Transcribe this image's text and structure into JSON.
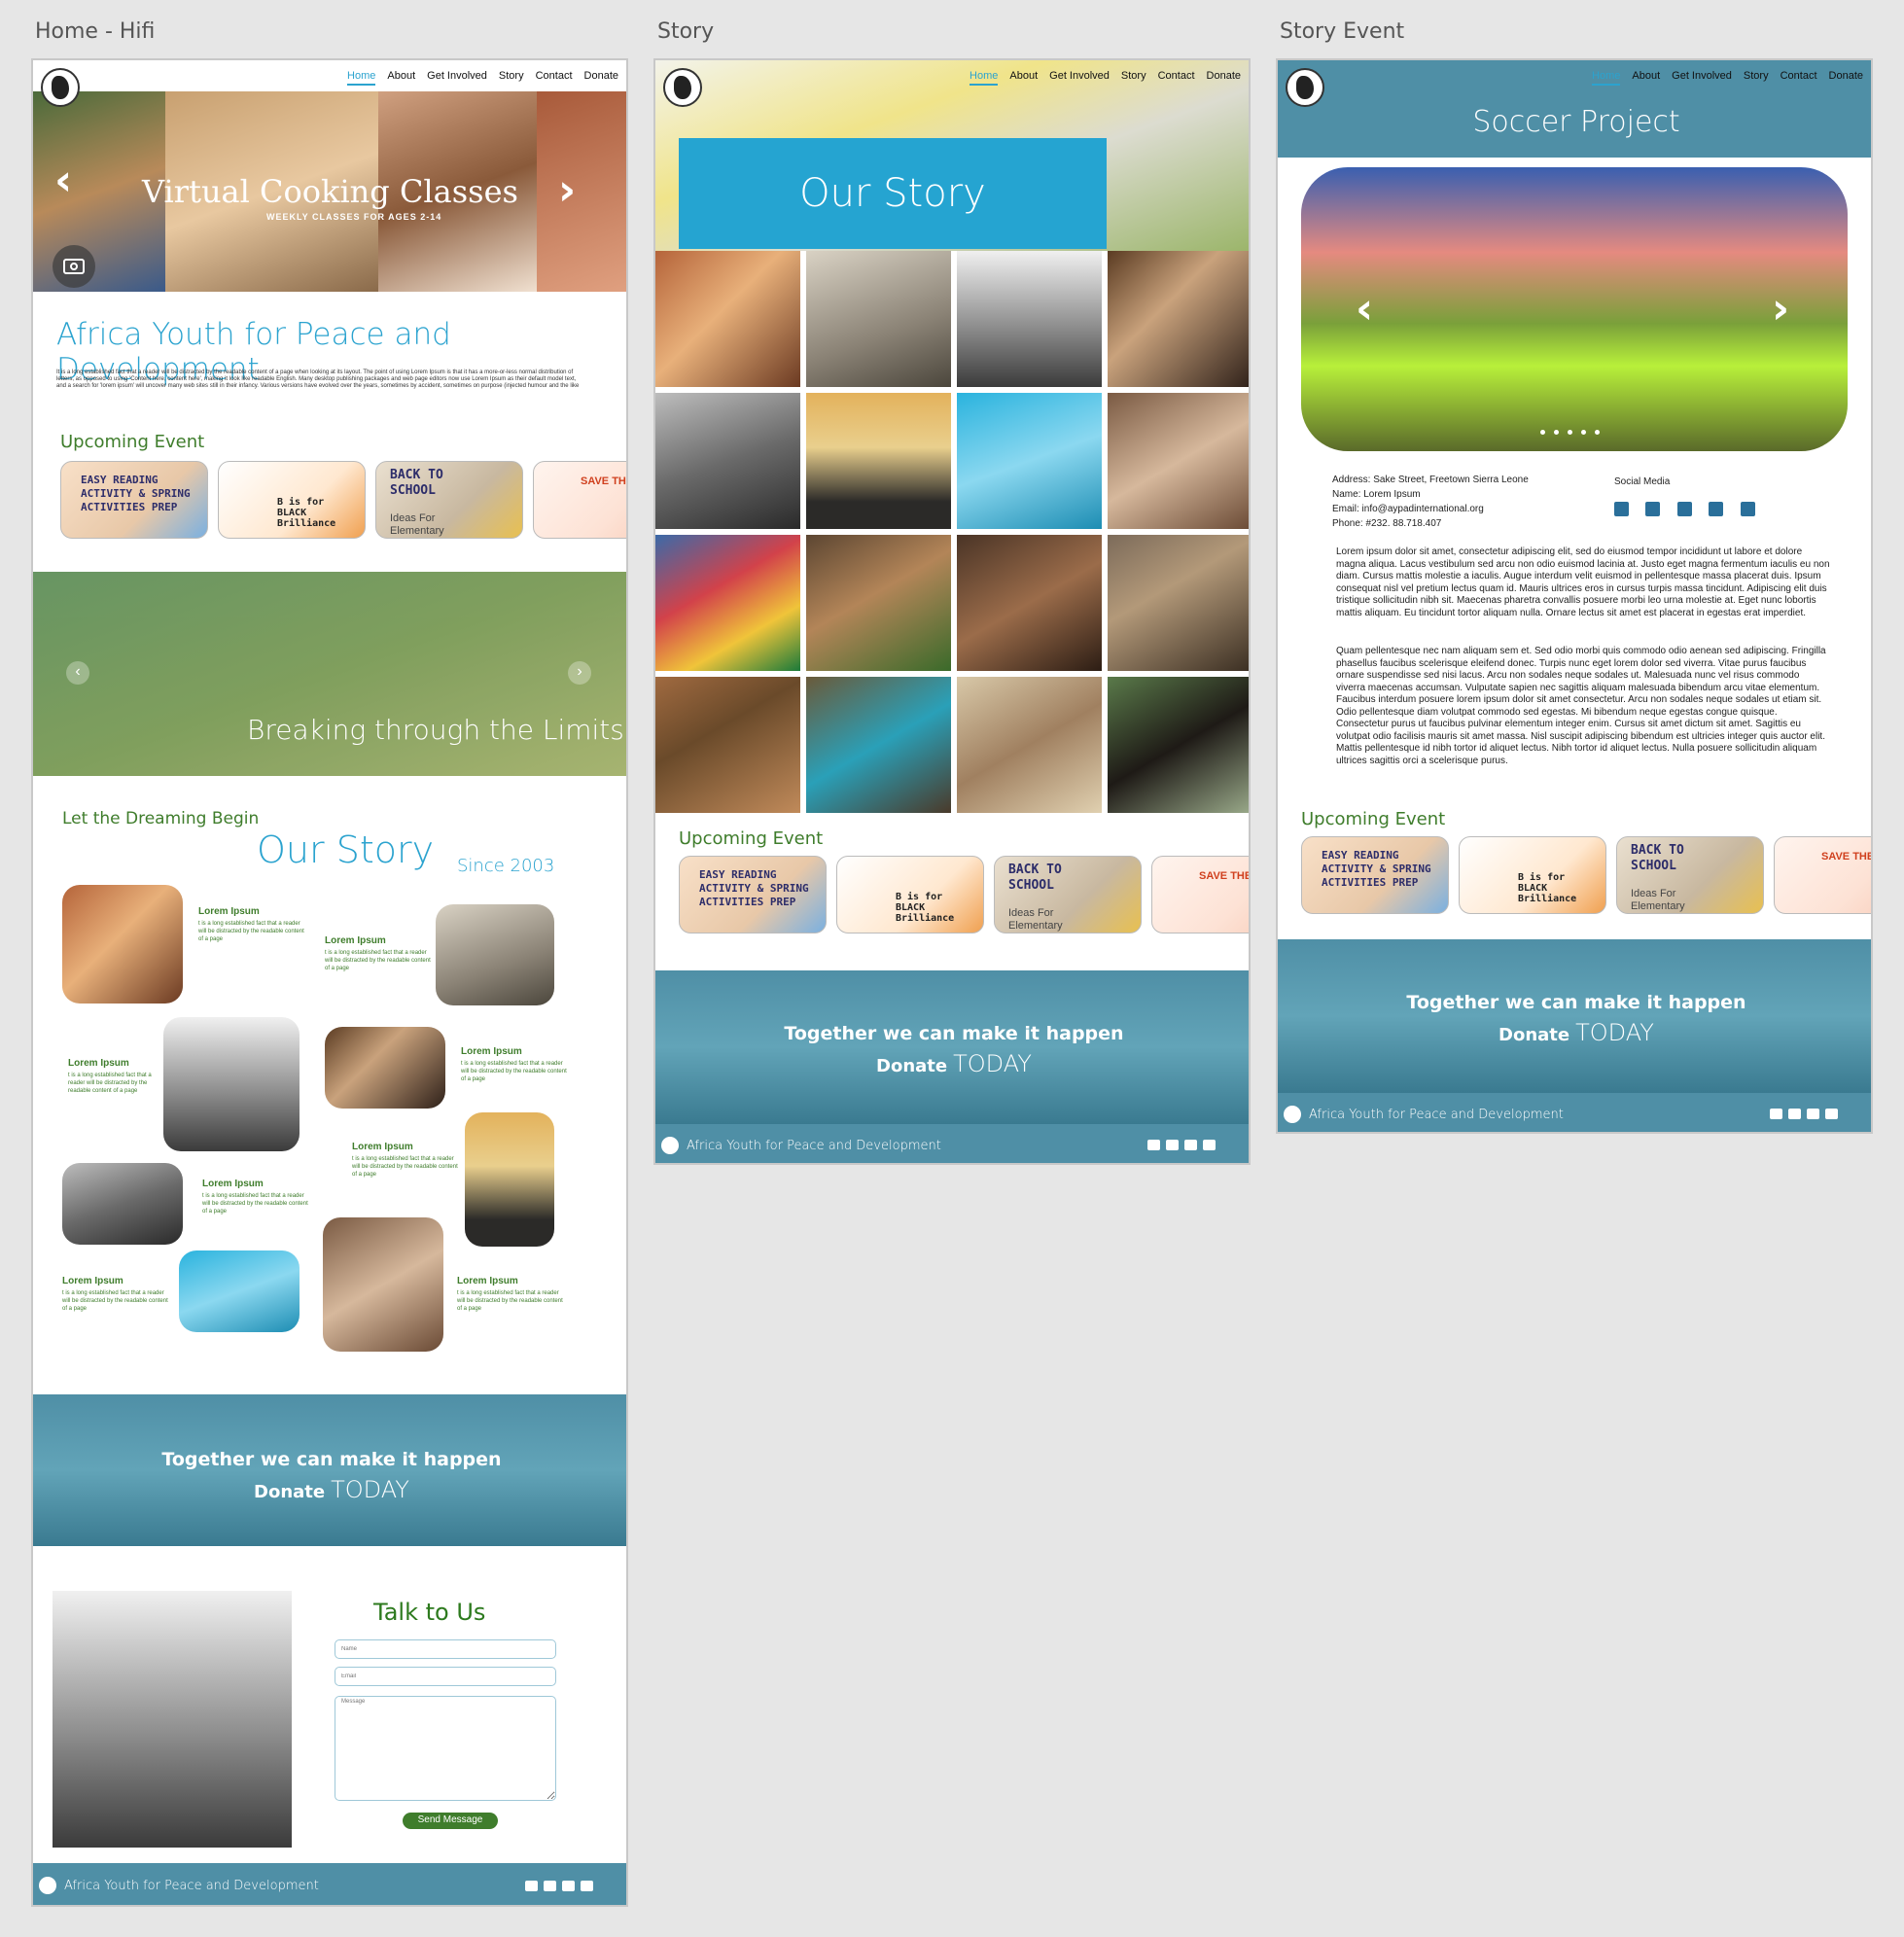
{
  "frames": {
    "home_label": "Home - Hifi",
    "story_label": "Story",
    "event_label": "Story Event"
  },
  "nav": [
    "Home",
    "About",
    "Get Involved",
    "Story",
    "Contact",
    "Donate"
  ],
  "home": {
    "hero_title": "Virtual Cooking Classes",
    "hero_subtitle": "WEEKLY CLASSES FOR AGES 2-14",
    "org_title": "Africa Youth for Peace and Development",
    "intro": "It is a long established fact that a reader will be distracted by the readable content of a page when looking at its layout. The point of using Lorem Ipsum is that it has a more-or-less normal distribution of letters, as opposed to using 'Content here, content here', making it look like readable English. Many desktop publishing packages and web page editors now use Lorem Ipsum as their default model text, and a search for 'lorem ipsum' will uncover many web sites still in their infancy. Various versions have evolved over the years, sometimes by accident, sometimes on purpose (injected humour and the like",
    "upcoming_title": "Upcoming Event",
    "banner_text": "Breaking through the Limits",
    "dream_label": "Let the Dreaming Begin",
    "story_title": "Our Story",
    "since": "Since 2003",
    "lorem_title": "Lorem Ipsum",
    "lorem_body": "t is a long established fact that a reader will be distracted by the readable content of a page",
    "talk_title": "Talk to Us",
    "name_placeholder": "Name",
    "email_placeholder": "Email",
    "message_placeholder": "Message",
    "send_label": "Send Message"
  },
  "events": [
    {
      "line1": "EASY READING",
      "line2": "ACTIVITY & SPRING",
      "line3": "ACTIVITIES PREP"
    },
    {
      "line1": "B is for",
      "line2": "BLACK",
      "line3": "Brilliance"
    },
    {
      "line1": "BACK TO",
      "line2": "SCHOOL",
      "line3": "Ideas For Elementary"
    },
    {
      "line1": "SAVE THE",
      "line2": "",
      "line3": ""
    }
  ],
  "donate": {
    "line1": "Together we can make it happen",
    "line2a": "Donate",
    "line2b": "TODAY"
  },
  "footer": {
    "text": "Africa Youth for Peace and Development"
  },
  "story": {
    "title": "Our Story"
  },
  "event_page": {
    "title": "Soccer Project",
    "address": "Address: Sake Street, Freetown Sierra Leone",
    "name": "Name: Lorem Ipsum",
    "email": "Email: info@aypadinternational.org",
    "phone": "Phone: #232. 88.718.407",
    "social_label": "Social Media",
    "para1": "Lorem ipsum dolor sit amet, consectetur adipiscing elit, sed do eiusmod tempor incididunt ut labore et dolore magna aliqua. Lacus vestibulum sed arcu non odio euismod lacinia at. Justo eget magna fermentum iaculis eu non diam. Cursus mattis molestie a iaculis. Augue interdum velit euismod in pellentesque massa placerat duis. Ipsum consequat nisl vel pretium lectus quam id. Mauris ultrices eros in cursus turpis massa tincidunt. Adipiscing elit duis tristique sollicitudin nibh sit. Maecenas pharetra convallis posuere morbi leo urna molestie at. Eget nunc lobortis mattis aliquam. Eu tincidunt tortor aliquam nulla. Ornare lectus sit amet est placerat in egestas erat imperdiet.",
    "para2": "Quam pellentesque nec nam aliquam sem et. Sed odio morbi quis commodo odio aenean sed adipiscing. Fringilla phasellus faucibus scelerisque eleifend donec. Turpis nunc eget lorem dolor sed viverra. Vitae purus faucibus ornare suspendisse sed nisi lacus. Arcu non sodales neque sodales ut. Malesuada nunc vel risus commodo viverra maecenas accumsan. Vulputate sapien nec sagittis aliquam malesuada bibendum arcu vitae elementum. Faucibus interdum posuere lorem ipsum dolor sit amet consectetur. Arcu non sodales neque sodales ut etiam sit. Odio pellentesque diam volutpat commodo sed egestas. Mi bibendum neque egestas congue quisque. Consectetur purus ut faucibus pulvinar elementum integer enim. Cursus sit amet dictum sit amet. Sagittis eu volutpat odio facilisis mauris sit amet massa. Nisl suscipit adipiscing bibendum est ultricies integer quis auctor elit. Mattis pellentesque id nibh tortor id aliquet lectus. Nibh tortor id aliquet lectus. Nulla posuere sollicitudin aliquam ultrices sagittis orci a scelerisque purus."
  },
  "icons": {
    "prev": "chevron-left-icon",
    "next": "chevron-right-icon",
    "camera": "camera-icon",
    "mail": "mail-icon",
    "phone": "phone-icon",
    "linkedin": "linkedin-icon",
    "youtube": "youtube-icon"
  },
  "colors": {
    "accent_blue": "#2ba3cf",
    "teal": "#4f8fa6",
    "green": "#3f7d2c"
  }
}
